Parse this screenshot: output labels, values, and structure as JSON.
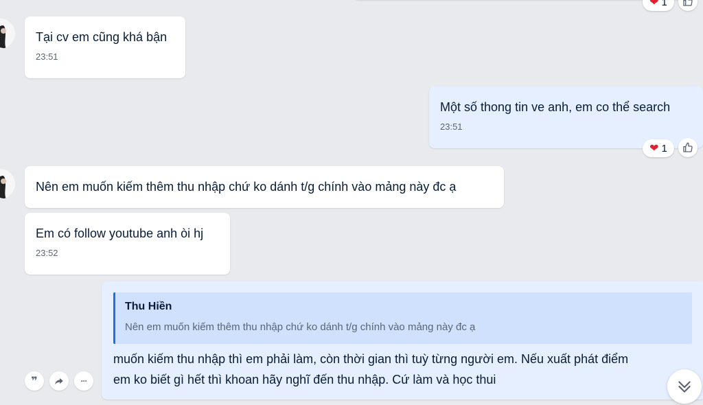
{
  "messages": [
    {
      "text": "Tại cv em cũng khá bận",
      "time": "23:51"
    },
    {
      "text": "Một số thong tin ve anh, em co thể search",
      "time": "23:51",
      "reaction_heart": "❤",
      "reaction_count": "1"
    },
    {
      "text": "Nên em muốn kiếm thêm thu nhập chứ ko dánh t/g chính vào mảng này đc ạ"
    },
    {
      "text": "Em có follow youtube anh òi hj",
      "time": "23:52"
    }
  ],
  "top_reaction": {
    "heart": "❤",
    "count": "1"
  },
  "reply": {
    "quoted_name": "Thu Hiền",
    "quoted_text": "Nên em muốn kiếm thêm thu nhập chứ ko dánh t/g chính vào mảng này đc ạ",
    "line1": "muốn kiếm thu nhập thì em phải làm, còn thời gian thì tuỳ từng người em. Nếu xuất phát điểm",
    "line2": "em ko biết gì hết thì khoan hãy nghĩ đến thu nhập. Cứ làm và học thui"
  },
  "actions": {
    "quote_icon": "❞",
    "more_icon": "···"
  },
  "colors": {
    "background": "#e9eaed",
    "incoming": "#ffffff",
    "outgoing": "#e5efff",
    "quote_bg": "#cfe1fd",
    "quote_bar": "#1a6ef2",
    "heart": "#e2202f"
  },
  "icons": [
    "thumbs-up-icon",
    "quote-icon",
    "share-icon",
    "more-icon",
    "double-chevron-down-icon",
    "heart-icon"
  ]
}
